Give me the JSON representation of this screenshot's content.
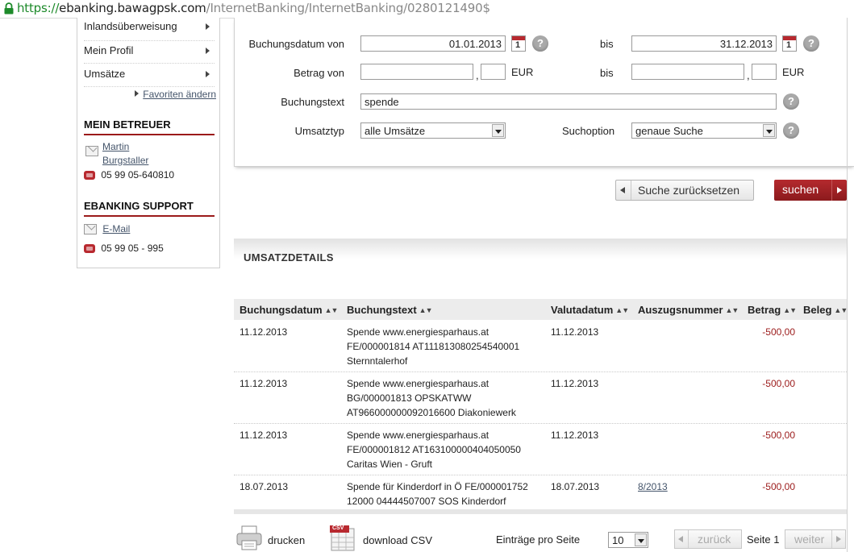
{
  "browser": {
    "url_scheme": "https://",
    "url_host": "ebanking.bawagpsk.com",
    "url_path": "/InternetBanking/InternetBanking/0280121490$"
  },
  "sidebar": {
    "items": [
      {
        "label": "Inlandsüberweisung"
      },
      {
        "label": "Mein Profil"
      },
      {
        "label": "Umsätze"
      }
    ],
    "favorites_link": "Favoriten ändern",
    "advisor": {
      "heading": "MEIN BETREUER",
      "name_line1": "Martin",
      "name_line2": "Burgstaller",
      "phone": "05 99 05-640810"
    },
    "support": {
      "heading": "EBANKING SUPPORT",
      "email_link": "E-Mail",
      "phone": "05 99 05 - 995"
    }
  },
  "search": {
    "date_from_label": "Buchungsdatum von",
    "date_from_value": "01.01.2013",
    "date_to_label": "bis",
    "date_to_value": "31.12.2013",
    "calendar_glyph": "1",
    "amount_from_label": "Betrag von",
    "amount_to_label": "bis",
    "decimal_sep": ",",
    "currency": "EUR",
    "text_label": "Buchungstext",
    "text_value": "spende",
    "type_label": "Umsatztyp",
    "type_value": "alle Umsätze",
    "option_label": "Suchoption",
    "option_value": "genaue Suche",
    "help_glyph": "?",
    "reset_button": "Suche zurücksetzen",
    "search_button": "suchen"
  },
  "details": {
    "section_title": "UMSATZDETAILS",
    "columns": [
      "Buchungsdatum",
      "Buchungstext",
      "Valutadatum",
      "Auszugsnummer",
      "Betrag",
      "Beleg"
    ],
    "sort_glyph": "▲▼",
    "rows": [
      {
        "booking_date": "11.12.2013",
        "text_lines": [
          "Spende www.energiesparhaus.at",
          "FE/000001814 AT111813080254540001",
          "Sternntalerhof"
        ],
        "value_date": "11.12.2013",
        "statement_no": "",
        "amount": "-500,00"
      },
      {
        "booking_date": "11.12.2013",
        "text_lines": [
          "Spende www.energiesparhaus.at",
          "BG/000001813 OPSKATWW",
          "AT966000000092016600 Diakoniewerk"
        ],
        "value_date": "11.12.2013",
        "statement_no": "",
        "amount": "-500,00"
      },
      {
        "booking_date": "11.12.2013",
        "text_lines": [
          "Spende www.energiesparhaus.at",
          "FE/000001812 AT163100000404050050",
          "Caritas Wien - Gruft"
        ],
        "value_date": "11.12.2013",
        "statement_no": "",
        "amount": "-500,00"
      },
      {
        "booking_date": "18.07.2013",
        "text_lines": [
          "Spende für Kinderdorf in Ö FE/000001752",
          "12000 04444507007 SOS Kinderdorf"
        ],
        "value_date": "18.07.2013",
        "statement_no": "8/2013",
        "amount": "-500,00"
      }
    ]
  },
  "footer": {
    "print_label": "drucken",
    "csv_badge": "CSV",
    "csv_label": "download CSV",
    "per_page_label": "Einträge pro Seite",
    "per_page_value": "10",
    "prev_label": "zurück",
    "page_label": "Seite 1",
    "next_label": "weiter"
  },
  "colors": {
    "accent_red": "#9b1a1a",
    "link": "#44546a",
    "secure_green": "#1d8a2a"
  }
}
